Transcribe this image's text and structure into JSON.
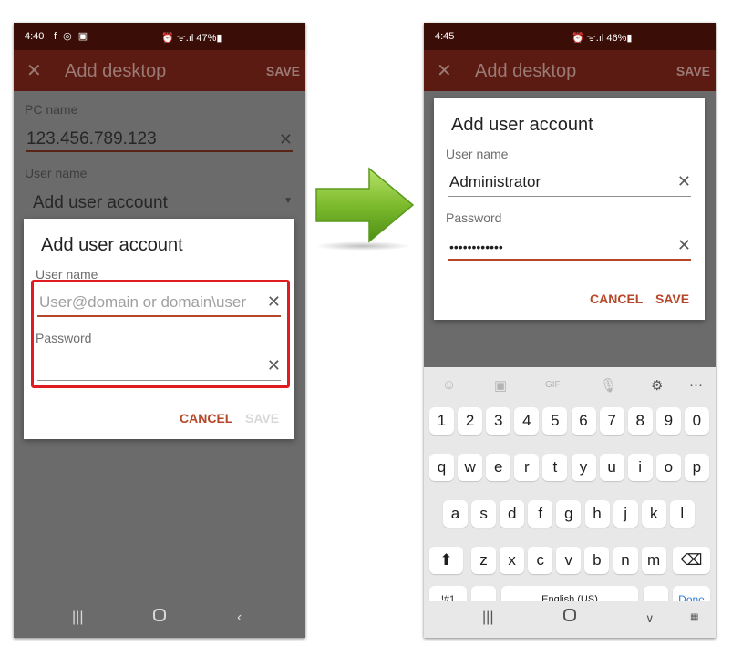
{
  "left": {
    "status": {
      "time": "4:40",
      "icons": "f ◎ ▣",
      "right": "⏰ ᯤ.ıl 47%▮"
    },
    "appbar": {
      "title": "Add desktop",
      "save": "SAVE"
    },
    "form": {
      "pc_label": "PC name",
      "pc_value": "123.456.789.123",
      "user_label": "User name",
      "user_value": "Add user account"
    },
    "dialog": {
      "title": "Add user account",
      "user_label": "User name",
      "user_placeholder": "User@domain or domain\\user",
      "password_label": "Password",
      "cancel": "CANCEL",
      "save": "SAVE"
    }
  },
  "right": {
    "status": {
      "time": "4:45",
      "right": "⏰ ᯤ.ıl 46%▮"
    },
    "appbar": {
      "title": "Add desktop",
      "save": "SAVE"
    },
    "dialog": {
      "title": "Add user account",
      "user_label": "User name",
      "user_value": "Administrator",
      "password_label": "Password",
      "password_value": "••••••••••••",
      "cancel": "CANCEL",
      "save": "SAVE"
    },
    "keyboard": {
      "numbers": [
        "1",
        "2",
        "3",
        "4",
        "5",
        "6",
        "7",
        "8",
        "9",
        "0"
      ],
      "row1": [
        "q",
        "w",
        "e",
        "r",
        "t",
        "y",
        "u",
        "i",
        "o",
        "p"
      ],
      "row2": [
        "a",
        "s",
        "d",
        "f",
        "g",
        "h",
        "j",
        "k",
        "l"
      ],
      "row3": [
        "z",
        "x",
        "c",
        "v",
        "b",
        "n",
        "m"
      ],
      "symbols_key": "!#1",
      "comma_key": ",",
      "space_label": "English (US)",
      "period_key": ".",
      "done_key": "Done"
    }
  },
  "nav_icons": [
    "recent-apps",
    "home",
    "back"
  ],
  "colors": {
    "accent": "#b7472a",
    "appbar": "#5b1b12",
    "highlight": "#e11b22",
    "arrow": "#7dbb2d"
  }
}
